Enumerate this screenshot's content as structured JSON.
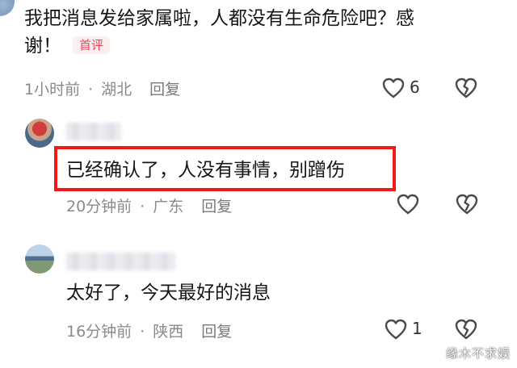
{
  "comment1": {
    "text_line1": "我把消息发给家属啦，人都没有生命危险吧？感",
    "text_line2": "谢！",
    "badge": "首评",
    "time": "1小时前",
    "location": "湖北",
    "reply": "回复",
    "like_count": "6"
  },
  "reply1": {
    "text": "已经确认了，人没有事情，别蹭伤",
    "time": "20分钟前",
    "location": "广东",
    "reply": "回复"
  },
  "reply2": {
    "text": "太好了，今天最好的消息",
    "time": "16分钟前",
    "location": "陕西",
    "reply": "回复",
    "like_count": "1"
  },
  "watermark": "缘木不求娱",
  "colors": {
    "highlight": "#f01818",
    "badge_text": "#e8475b",
    "badge_bg": "#fdeef0",
    "meta_text": "#8a8a8a"
  },
  "icons": [
    "heart-outline-icon",
    "broken-heart-icon"
  ]
}
